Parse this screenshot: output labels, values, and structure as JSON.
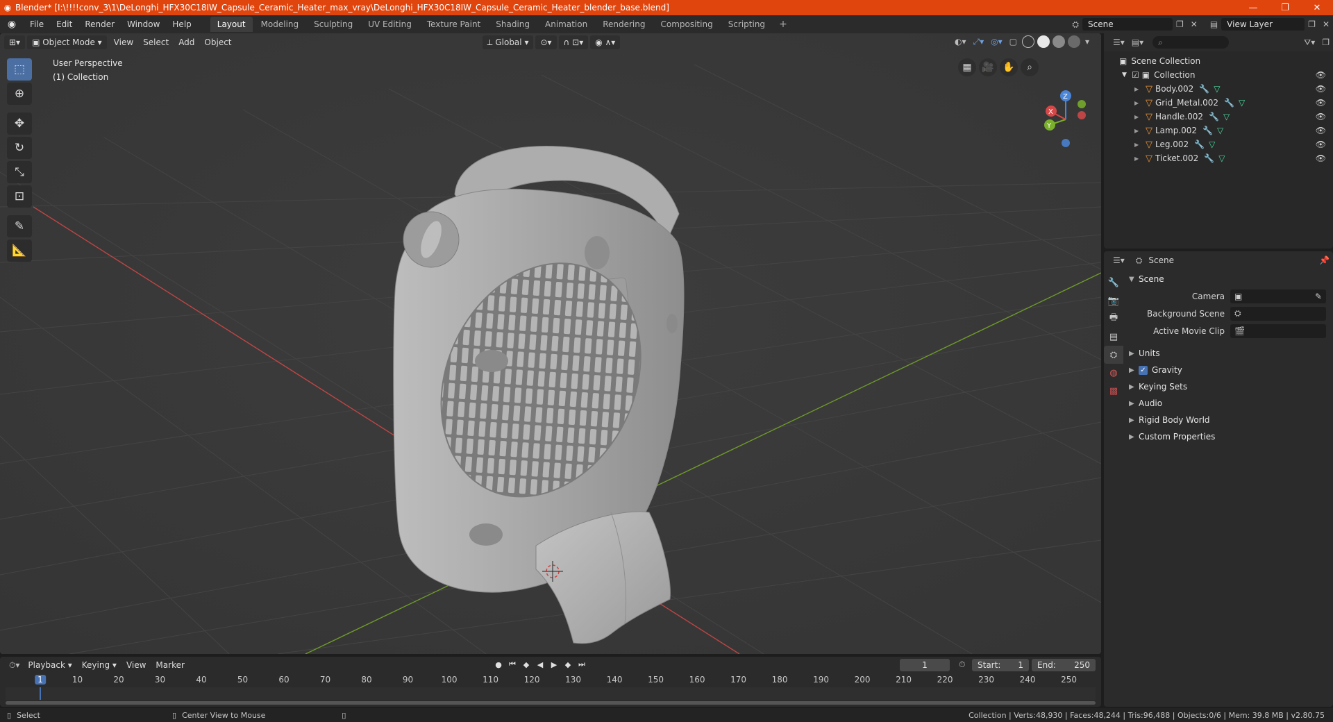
{
  "window": {
    "title": "Blender* [I:\\!!!!conv_3\\1\\DeLonghi_HFX30C18IW_Capsule_Ceramic_Heater_max_vray\\DeLonghi_HFX30C18IW_Capsule_Ceramic_Heater_blender_base.blend]",
    "minimize": "—",
    "maximize": "❐",
    "close": "✕"
  },
  "menu": {
    "items": [
      "File",
      "Edit",
      "Render",
      "Window",
      "Help"
    ]
  },
  "workspaces": {
    "tabs": [
      "Layout",
      "Modeling",
      "Sculpting",
      "UV Editing",
      "Texture Paint",
      "Shading",
      "Animation",
      "Rendering",
      "Compositing",
      "Scripting"
    ],
    "active": "Layout",
    "add": "+"
  },
  "scene_selector": {
    "value": "Scene"
  },
  "view_layer_selector": {
    "value": "View Layer"
  },
  "viewport": {
    "mode": "Object Mode",
    "menus": [
      "View",
      "Select",
      "Add",
      "Object"
    ],
    "transform_orientation": "Global",
    "perspective_label": "User Perspective",
    "collection_label": "(1) Collection",
    "gizmo": {
      "x": "X",
      "y": "Y",
      "z": "Z"
    }
  },
  "outliner": {
    "search_placeholder": "",
    "scene_collection": "Scene Collection",
    "collection": "Collection",
    "objects": [
      "Body.002",
      "Grid_Metal.002",
      "Handle.002",
      "Lamp.002",
      "Leg.002",
      "Ticket.002"
    ]
  },
  "properties": {
    "context": "Scene",
    "panel_title": "Scene",
    "fields": {
      "camera_label": "Camera",
      "background_scene_label": "Background Scene",
      "active_movie_clip_label": "Active Movie Clip"
    },
    "subpanels": [
      "Units",
      "Gravity",
      "Keying Sets",
      "Audio",
      "Rigid Body World",
      "Custom Properties"
    ],
    "gravity_checked": true
  },
  "timeline": {
    "menus": [
      "Playback",
      "Keying",
      "View",
      "Marker"
    ],
    "current_frame": "1",
    "start_label": "Start:",
    "start_value": "1",
    "end_label": "End:",
    "end_value": "250",
    "ruler": [
      "1",
      "10",
      "20",
      "30",
      "40",
      "50",
      "60",
      "70",
      "80",
      "90",
      "100",
      "110",
      "120",
      "130",
      "140",
      "150",
      "160",
      "170",
      "180",
      "190",
      "200",
      "210",
      "220",
      "230",
      "240",
      "250"
    ]
  },
  "statusbar": {
    "left_action": "Select",
    "middle_action": "Center View to Mouse",
    "stats": "Collection | Verts:48,930 | Faces:48,244 | Tris:96,488 | Objects:0/6 | Mem: 39.8 MB | v2.80.75"
  },
  "colors": {
    "title_bar": "#e0450e",
    "accent_blue": "#4772b3",
    "object_orange": "#f29634",
    "x_axis": "#d44848",
    "y_axis": "#7ab02c",
    "z_axis": "#4a85d8"
  }
}
